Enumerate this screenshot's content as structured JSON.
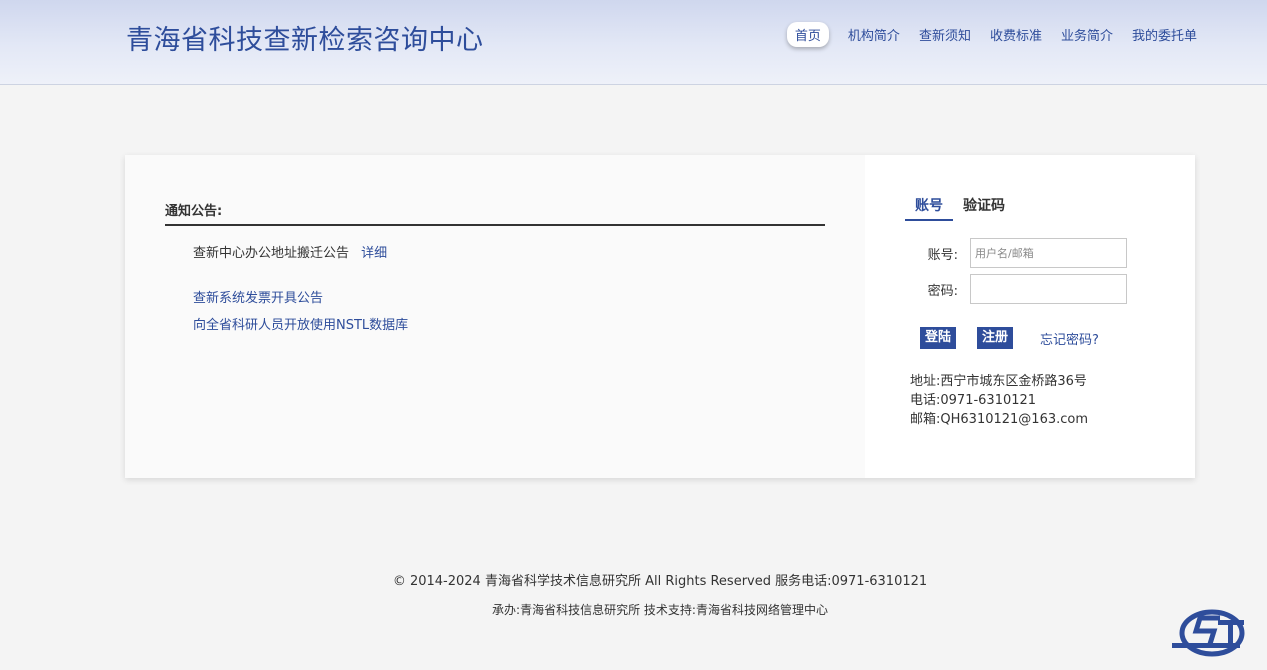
{
  "header": {
    "title": "青海省科技查新检索咨询中心",
    "nav": [
      "首页",
      "机构简介",
      "查新须知",
      "收费标准",
      "业务简介",
      "我的委托单"
    ]
  },
  "notices": {
    "heading": "通知公告:",
    "items": [
      {
        "text": "查新中心办公地址搬迁公告",
        "detail": "详细"
      },
      {
        "text": "查新系统发票开具公告"
      },
      {
        "text": "向全省科研人员开放使用NSTL数据库"
      }
    ]
  },
  "login": {
    "tabs": [
      "账号",
      "验证码"
    ],
    "account_label": "账号:",
    "account_placeholder": "用户名/邮箱",
    "password_label": "密码:",
    "login_button": "登陆",
    "register_button": "注册",
    "forgot": "忘记密码?"
  },
  "contact": {
    "address_label": "地址:",
    "address": "西宁市城东区金桥路36号",
    "phone_label": "电话:",
    "phone": "0971-6310121",
    "email_label": "邮箱:",
    "email": "QH6310121@163.com"
  },
  "footer": {
    "line1": "© 2014-2024 青海省科学技术信息研究所 All Rights Reserved 服务电话:0971-6310121",
    "line2": "承办:青海省科技信息研究所 技术支持:青海省科技网络管理中心"
  },
  "colors": {
    "accent": "#2e4d9b",
    "header_top": "#cfd7ee",
    "page_bg": "#f4f4f4"
  }
}
